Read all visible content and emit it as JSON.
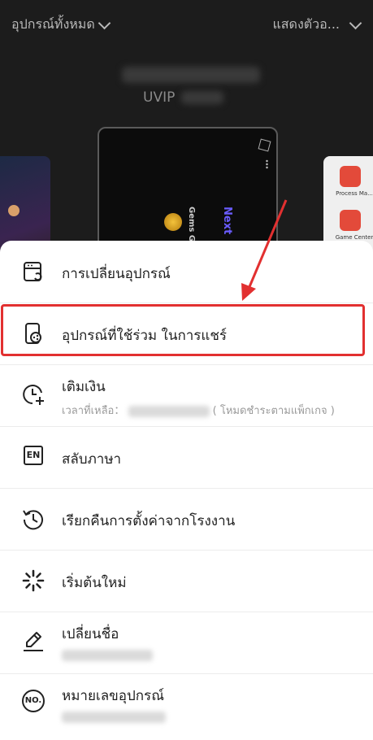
{
  "header": {
    "device_filter_label": "อุปกรณ์ทั้งหมด",
    "display_label": "แสดงตัวอ..."
  },
  "device_card": {
    "vip_label": "UVIP",
    "gems_text": "Gems Gems",
    "next_text": "Next"
  },
  "right_apps": [
    {
      "name": "Process Ma..."
    },
    {
      "name": "Game Center"
    }
  ],
  "menu": {
    "items": [
      {
        "label": "การเปลี่ยนอุปกรณ์",
        "icon": "device-switch-icon"
      },
      {
        "label": "อุปกรณ์ที่ใช้ร่วม ในการแชร์",
        "icon": "shared-device-icon"
      },
      {
        "label": "เติมเงิน",
        "sub_prefix": "เวลาที่เหลือ：",
        "sub_suffix": "( โหมดชำระตามแพ็กเกจ )",
        "icon": "clock-plus-icon"
      },
      {
        "label": "สลับภาษา",
        "icon_text": "EN",
        "icon": "language-icon"
      },
      {
        "label": "เรียกคืนการตั้งค่าจากโรงงาน",
        "icon": "restore-icon"
      },
      {
        "label": "เริ่มต้นใหม่",
        "icon": "restart-icon"
      },
      {
        "label": "เปลี่ยนชื่อ",
        "icon": "rename-icon"
      },
      {
        "label": "หมายเลขอุปกรณ์",
        "icon_text": "NO.",
        "icon": "device-number-icon"
      }
    ]
  },
  "colors": {
    "highlight": "#e23030",
    "arrow": "#e23030"
  }
}
